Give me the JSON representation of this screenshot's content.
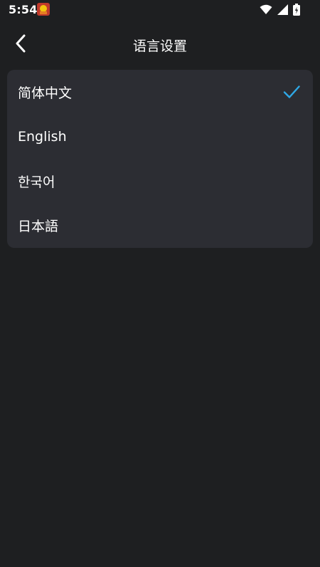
{
  "status_bar": {
    "time": "5:54",
    "app_icon": "app-notification-icon",
    "wifi_icon": "wifi-icon",
    "signal_icon": "cellular-signal-icon",
    "battery_icon": "battery-charging-icon"
  },
  "header": {
    "back_icon": "chevron-left-icon",
    "title": "语言设置"
  },
  "languages": [
    {
      "label": "简体中文",
      "selected": true
    },
    {
      "label": "English",
      "selected": false
    },
    {
      "label": "한국어",
      "selected": false
    },
    {
      "label": "日本語",
      "selected": false
    }
  ],
  "colors": {
    "background": "#1e1f21",
    "card": "#2c2d33",
    "text": "#ffffff",
    "accent_check": "#2fa8e6"
  }
}
